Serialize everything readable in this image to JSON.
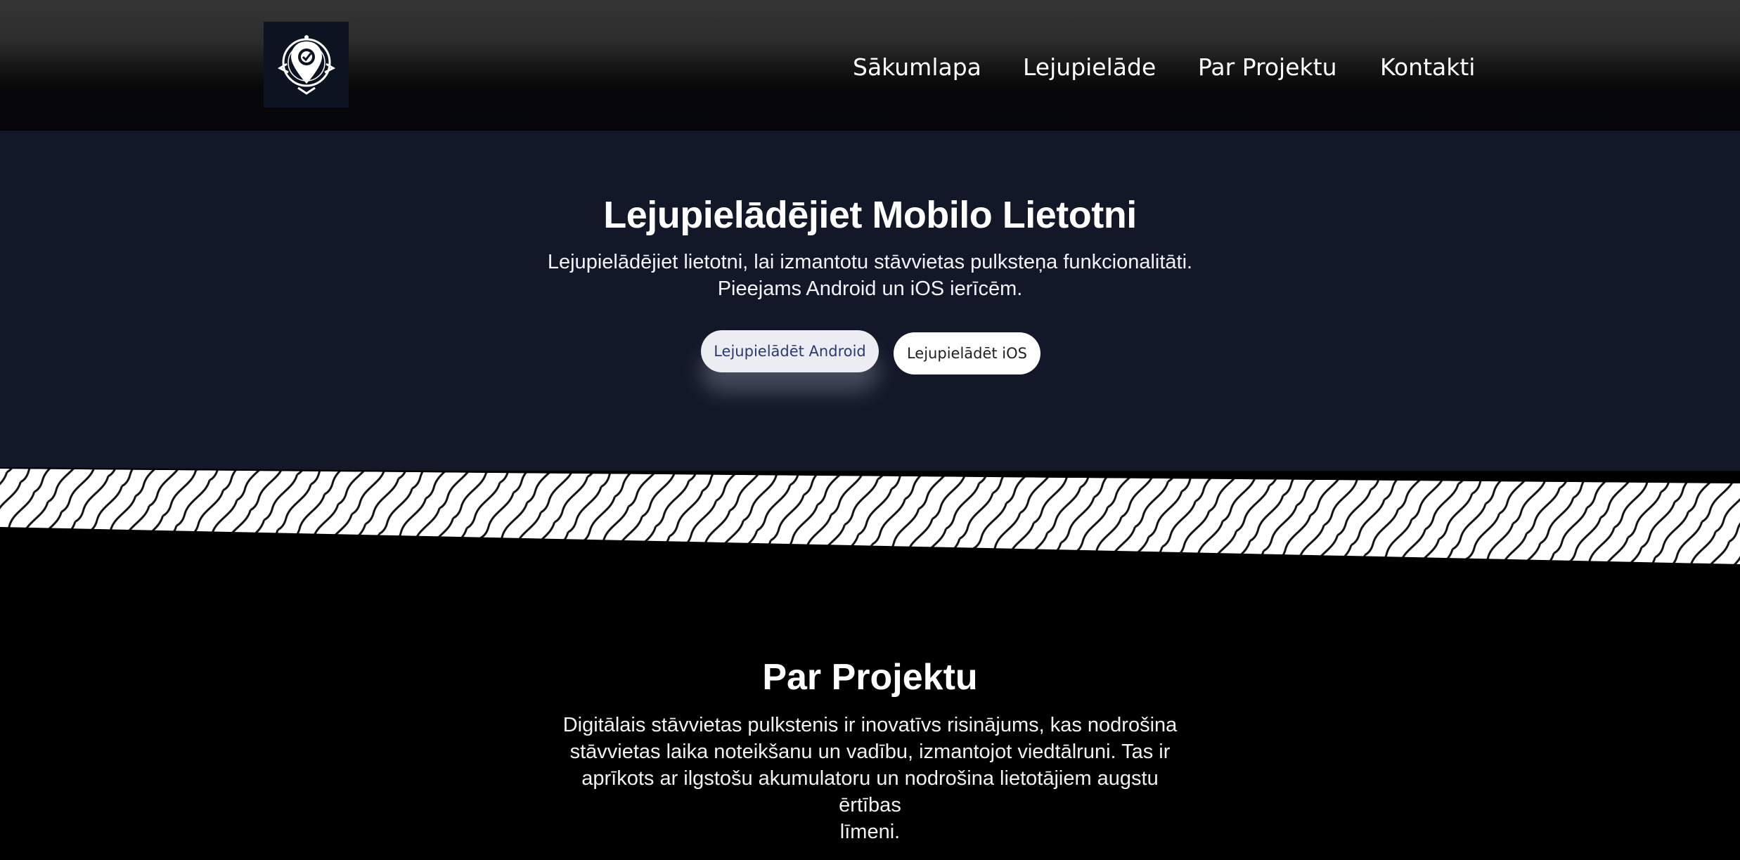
{
  "nav": {
    "logo_icon": "location-compass-logo-icon",
    "items": [
      {
        "label": "Sākumlapa"
      },
      {
        "label": "Lejupielāde"
      },
      {
        "label": "Par Projektu"
      },
      {
        "label": "Kontakti"
      }
    ]
  },
  "hero": {
    "title": "Lejupielādējiet Mobilo Lietotni",
    "text_line1": "Lejupielādējiet lietotni, lai izmantotu stāvvietas pulksteņa funkcionalitāti.",
    "text_line2": "Pieejams Android un iOS ierīcēm.",
    "android_button": "Lejupielādēt Android",
    "ios_button": "Lejupielādēt iOS"
  },
  "about": {
    "title": "Par Projektu",
    "text_lines": [
      "Digitālais stāvvietas pulkstenis ir inovatīvs risinājums, kas nodrošina",
      "stāvvietas laika noteikšanu un vadību, izmantojot viedtālruni. Tas ir",
      "aprīkots ar ilgstošu akumulatoru un nodrošina lietotājiem augstu ērtības",
      "līmeni."
    ]
  },
  "colors": {
    "header_bg": "#0b0b0d",
    "hero_bg": "#121828",
    "page_bg": "#000000",
    "android_button_bg": "#ebedf2",
    "android_button_text": "#2b3a6e",
    "ios_button_bg": "#ffffff"
  }
}
